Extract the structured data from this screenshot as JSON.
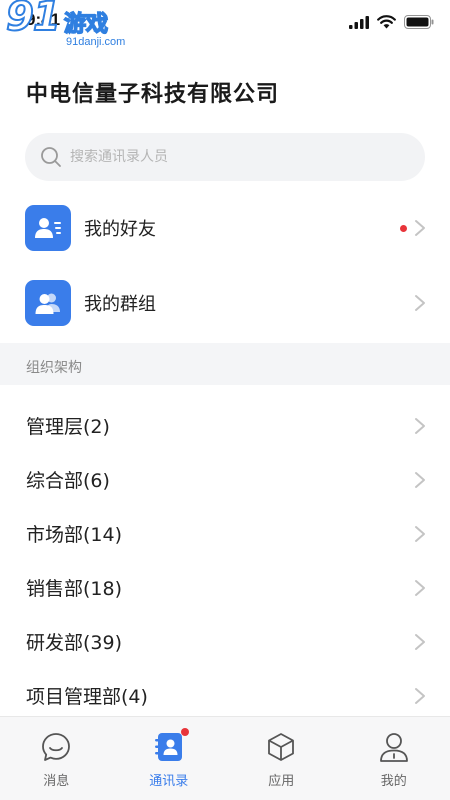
{
  "status_bar": {
    "time": "9:41"
  },
  "watermark": {
    "number": "91",
    "text": "游戏",
    "url": "91danji.com"
  },
  "company": {
    "name": "中电信量子科技有限公司"
  },
  "search": {
    "placeholder": "搜索通讯录人员"
  },
  "quick_items": [
    {
      "label": "我的好友",
      "has_badge": true
    },
    {
      "label": "我的群组",
      "has_badge": false
    }
  ],
  "section": {
    "label": "组织架构"
  },
  "departments": [
    {
      "label": "管理层(2)"
    },
    {
      "label": "综合部(6)"
    },
    {
      "label": "市场部(14)"
    },
    {
      "label": "销售部(18)"
    },
    {
      "label": "研发部(39)"
    },
    {
      "label": "项目管理部(4)"
    }
  ],
  "tabs": [
    {
      "label": "消息",
      "icon": "chat-icon",
      "active": false
    },
    {
      "label": "通讯录",
      "icon": "contacts-icon",
      "active": true
    },
    {
      "label": "应用",
      "icon": "cube-icon",
      "active": false
    },
    {
      "label": "我的",
      "icon": "person-icon",
      "active": false
    }
  ],
  "colors": {
    "accent": "#3a7dea",
    "badge": "#e8343a",
    "section_bg": "#f4f5f7"
  }
}
